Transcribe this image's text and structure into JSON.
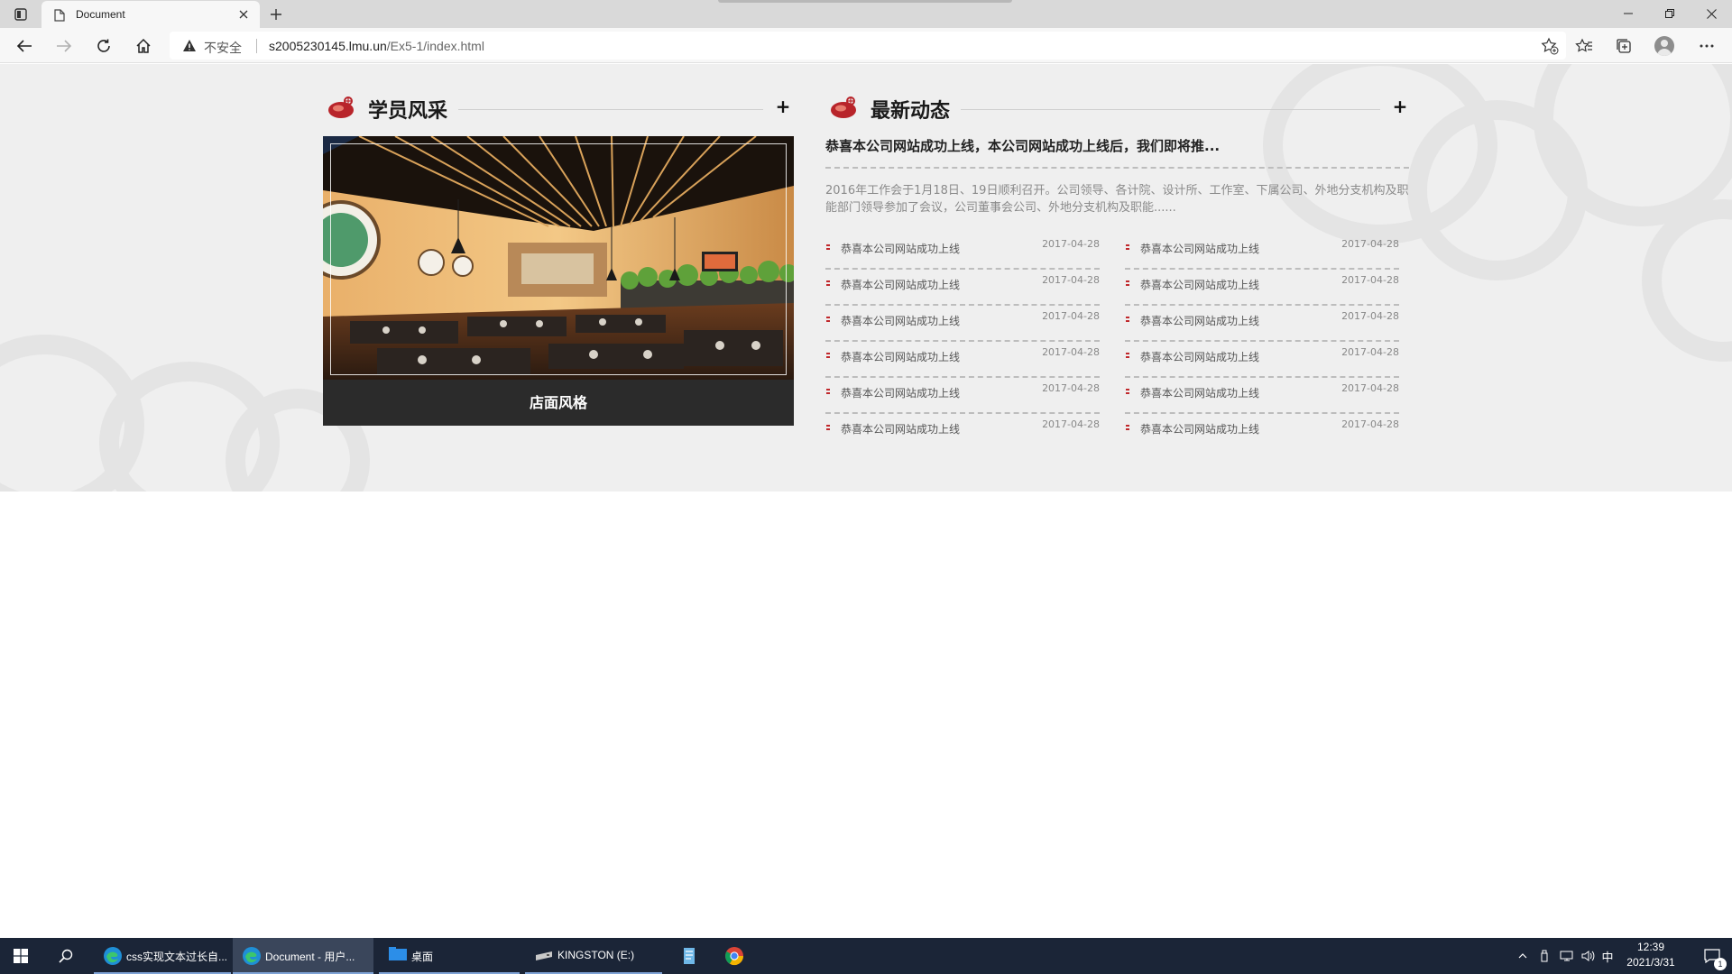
{
  "browser": {
    "tab_title": "Document",
    "security_label": "不安全",
    "url_host": "s2005230145.lmu.un",
    "url_path": "/Ex5-1/index.html"
  },
  "page": {
    "left_section": {
      "title": "学员风采",
      "more": "+",
      "caption": "店面风格"
    },
    "right_section": {
      "title": "最新动态",
      "more": "+",
      "headline": "恭喜本公司网站成功上线，本公司网站成功上线后，我们即将推...",
      "summary": "2016年工作会于1月18日、19日顺利召开。公司领导、各计院、设计所、工作室、下属公司、外地分支机构及职能部门领导参加了会议，公司董事会公司、外地分支机构及职能......",
      "news_left": [
        {
          "title": "恭喜本公司网站成功上线",
          "date": "2017-04-28"
        },
        {
          "title": "恭喜本公司网站成功上线",
          "date": "2017-04-28"
        },
        {
          "title": "恭喜本公司网站成功上线",
          "date": "2017-04-28"
        },
        {
          "title": "恭喜本公司网站成功上线",
          "date": "2017-04-28"
        },
        {
          "title": "恭喜本公司网站成功上线",
          "date": "2017-04-28"
        },
        {
          "title": "恭喜本公司网站成功上线",
          "date": "2017-04-28"
        }
      ],
      "news_right": [
        {
          "title": "恭喜本公司网站成功上线",
          "date": "2017-04-28"
        },
        {
          "title": "恭喜本公司网站成功上线",
          "date": "2017-04-28"
        },
        {
          "title": "恭喜本公司网站成功上线",
          "date": "2017-04-28"
        },
        {
          "title": "恭喜本公司网站成功上线",
          "date": "2017-04-28"
        },
        {
          "title": "恭喜本公司网站成功上线",
          "date": "2017-04-28"
        },
        {
          "title": "恭喜本公司网站成功上线",
          "date": "2017-04-28"
        }
      ]
    }
  },
  "taskbar": {
    "apps": [
      {
        "label": "css实现文本过长自..."
      },
      {
        "label": "Document - 用户..."
      },
      {
        "label": "桌面"
      },
      {
        "label": "KINGSTON (E:)"
      }
    ],
    "ime": "中",
    "time": "12:39",
    "date": "2021/3/31",
    "notifications": "1"
  },
  "colors": {
    "accent_red": "#c0282c",
    "caption_bg": "#2b2b2b",
    "taskbar_bg": "#1b2537"
  },
  "icons": [
    "tab-actions-icon",
    "document-icon",
    "close-icon",
    "plus-icon",
    "minimize-icon",
    "restore-icon",
    "back-icon",
    "forward-icon",
    "refresh-icon",
    "home-icon",
    "warning-icon",
    "favorite-add-icon",
    "favorites-icon",
    "collections-icon",
    "more-icon",
    "steak-icon",
    "windows-icon",
    "search-icon",
    "edge-icon",
    "folder-icon",
    "drive-icon",
    "chrome-icon",
    "notification-icon"
  ]
}
